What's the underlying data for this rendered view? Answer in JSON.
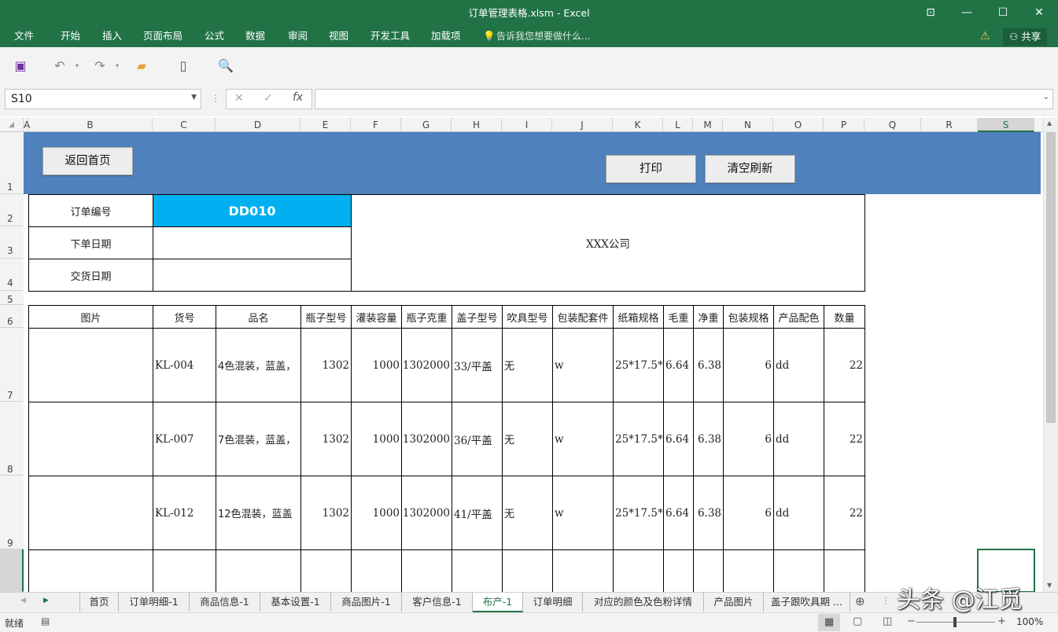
{
  "window": {
    "title": "订单管理表格.xlsm - Excel",
    "controls": {
      "ribbon_toggle": "⊡",
      "minimize": "—",
      "maximize": "☐",
      "close": "✕"
    }
  },
  "menu": {
    "items": [
      "文件",
      "开始",
      "插入",
      "页面布局",
      "公式",
      "数据",
      "审阅",
      "视图",
      "开发工具",
      "加载项"
    ],
    "tell_me": "告诉我您想要做什么...",
    "share": "共享"
  },
  "formula_bar": {
    "name_box": "S10",
    "formula": ""
  },
  "grid": {
    "columns": [
      "A",
      "B",
      "C",
      "D",
      "E",
      "F",
      "G",
      "H",
      "I",
      "J",
      "K",
      "L",
      "M",
      "N",
      "O",
      "P",
      "Q",
      "R",
      "S"
    ],
    "rows": [
      "1",
      "2",
      "3",
      "4",
      "5",
      "6",
      "7",
      "8",
      "9"
    ]
  },
  "sheet": {
    "buttons": {
      "home": "返回首页",
      "print": "打印",
      "clear": "清空刷新"
    },
    "info_labels": {
      "order_no": "订单编号",
      "order_date": "下单日期",
      "delivery_date": "交货日期"
    },
    "order_no": "DD010",
    "company": "XXX公司",
    "table_headers": [
      "图片",
      "货号",
      "品名",
      "瓶子型号",
      "灌装容量",
      "瓶子克重",
      "盖子型号",
      "吹具型号",
      "包装配套件",
      "纸箱规格",
      "毛重",
      "净重",
      "包装规格",
      "产品配色",
      "数量"
    ],
    "rows": [
      {
        "code": "KL-004",
        "name": "4色混装，蓝盖，",
        "bottle": "1302",
        "capacity": "1000",
        "weight": "1302000",
        "cap": "33/平盖",
        "blower": "无",
        "package": "w",
        "carton": "25*17.5*",
        "gross": "6.64",
        "net": "6.38",
        "spec": "6",
        "color": "dd",
        "qty": "22"
      },
      {
        "code": "KL-007",
        "name": "7色混装，蓝盖，",
        "bottle": "1302",
        "capacity": "1000",
        "weight": "1302000",
        "cap": "36/平盖",
        "blower": "无",
        "package": "w",
        "carton": "25*17.5*",
        "gross": "6.64",
        "net": "6.38",
        "spec": "6",
        "color": "dd",
        "qty": "22"
      },
      {
        "code": "KL-012",
        "name": "12色混装，蓝盖",
        "bottle": "1302",
        "capacity": "1000",
        "weight": "1302000",
        "cap": "41/平盖",
        "blower": "无",
        "package": "w",
        "carton": "25*17.5*",
        "gross": "6.64",
        "net": "6.38",
        "spec": "6",
        "color": "dd",
        "qty": "22"
      }
    ]
  },
  "sheet_tabs": {
    "tabs": [
      "首页",
      "订单明细-1",
      "商品信息-1",
      "基本设置-1",
      "商品图片-1",
      "客户信息-1",
      "布产-1",
      "订单明细",
      "对应的颜色及色粉详情",
      "产品图片",
      "盖子跟吹具期 ..."
    ],
    "active": "布产-1"
  },
  "status": {
    "ready": "就绪",
    "zoom": "100%"
  },
  "watermark": "头条 @江觅",
  "colors": {
    "ribbon": "#217346",
    "banner": "#4f81bd",
    "order_no_bg": "#00b0f0",
    "active_tab": "#217346"
  }
}
